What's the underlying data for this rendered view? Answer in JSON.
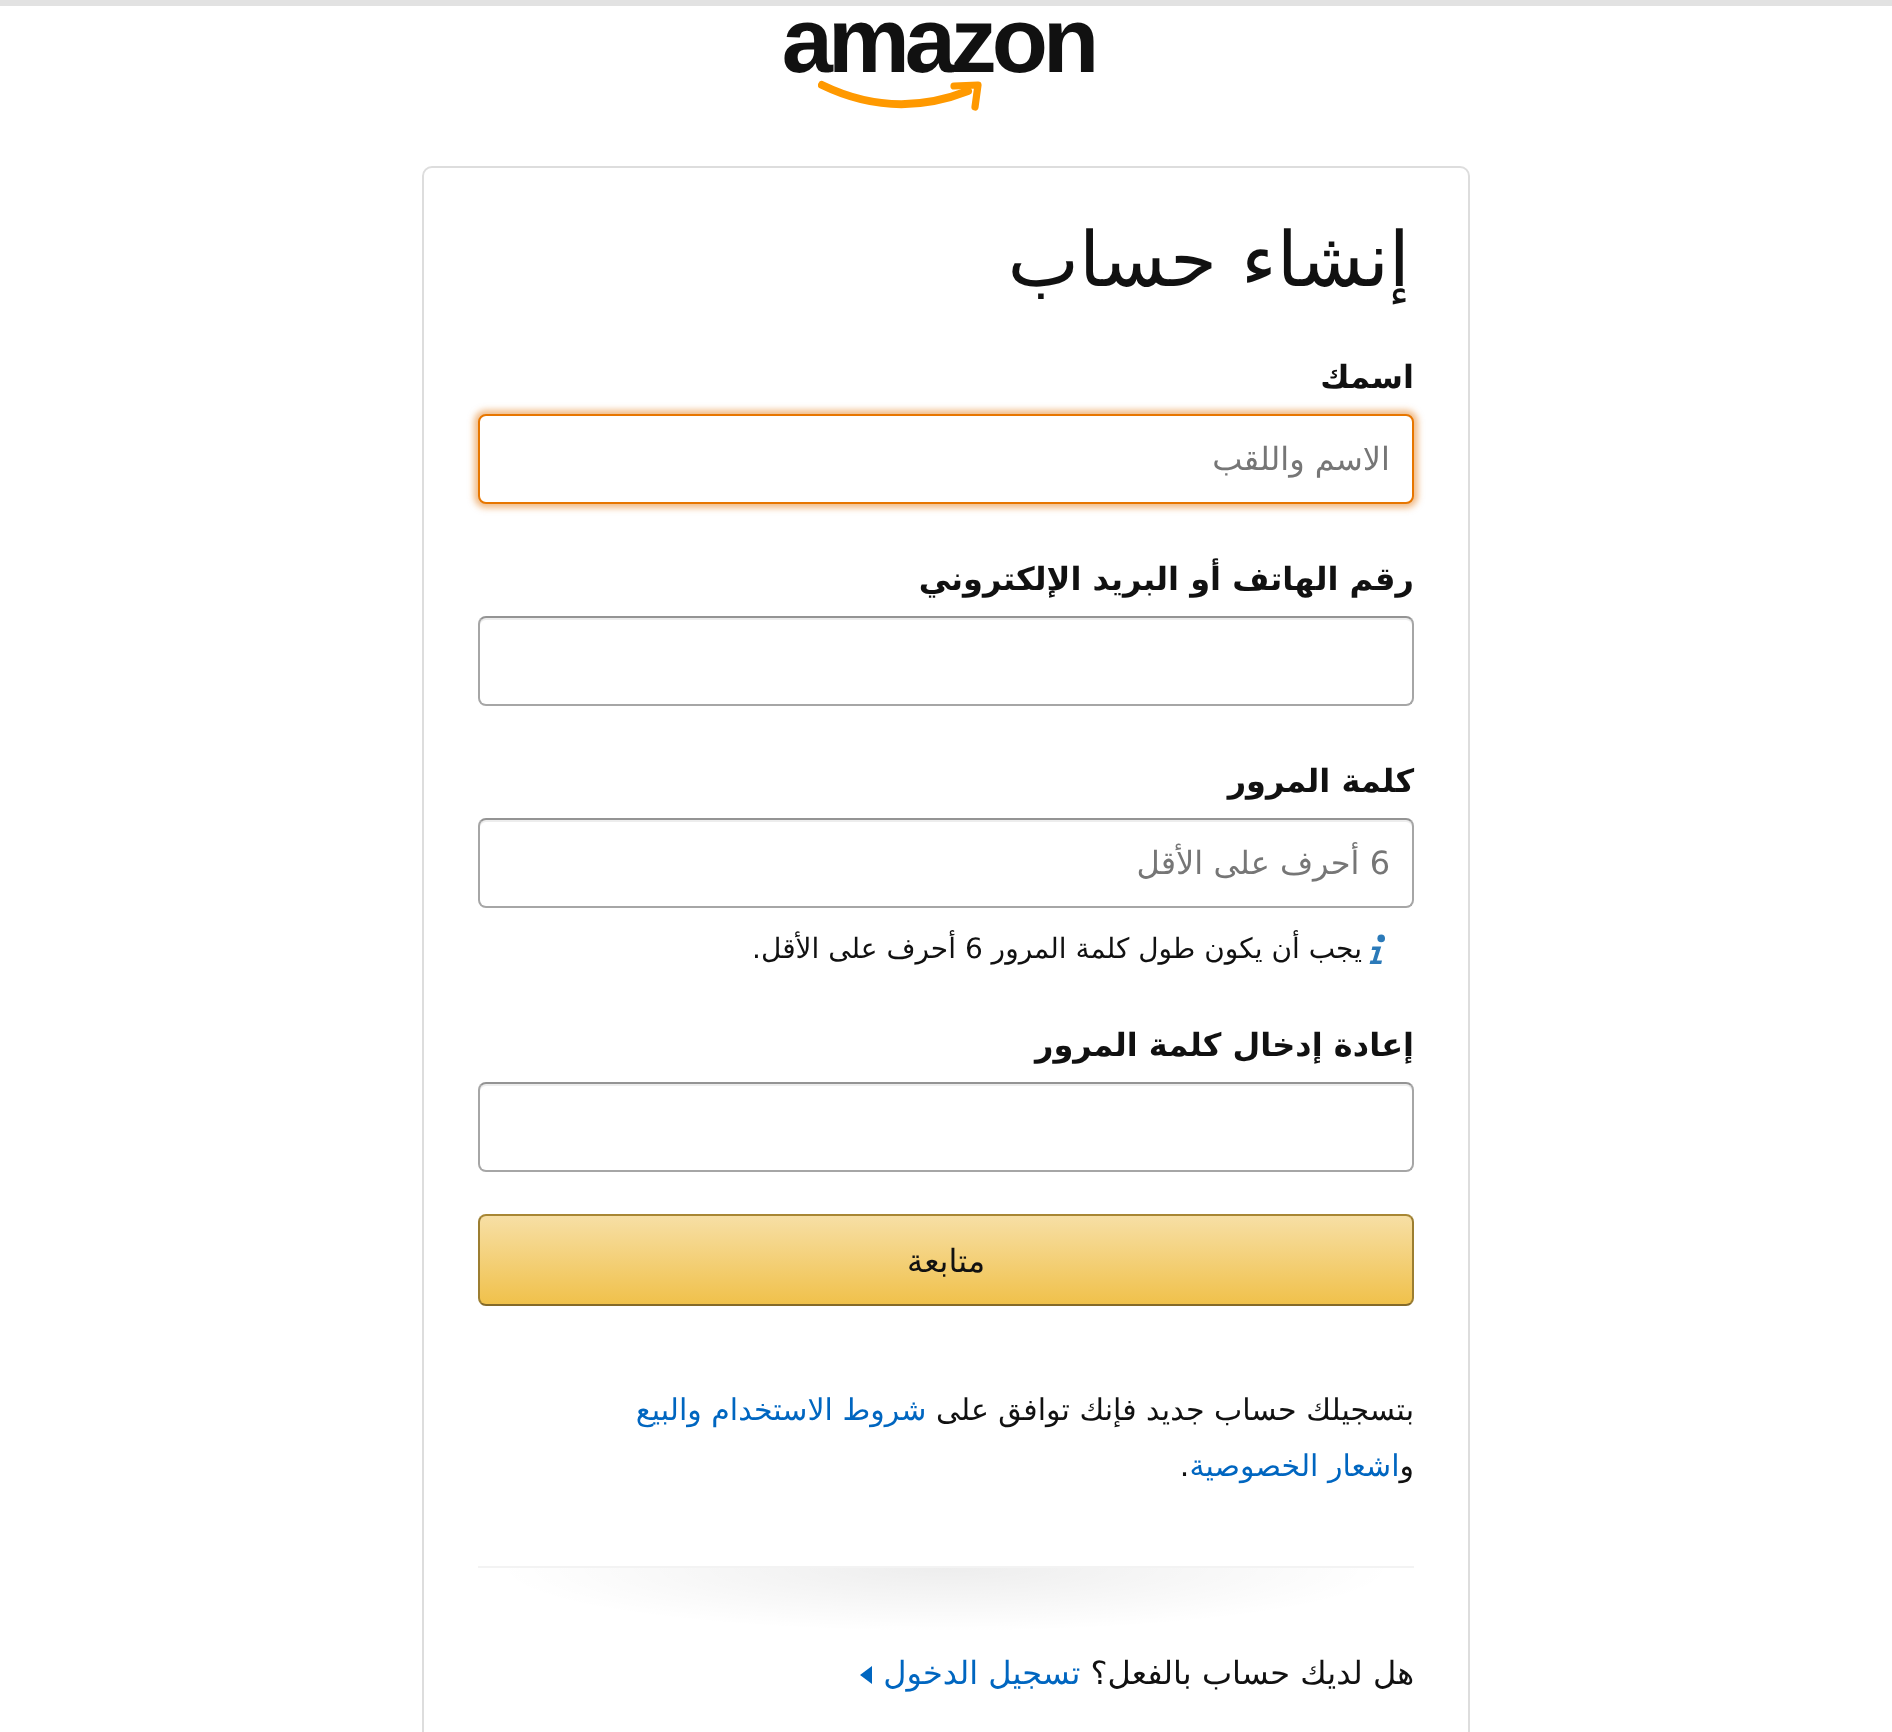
{
  "logo": {
    "text": "amazon"
  },
  "form": {
    "title": "إنشاء حساب",
    "fields": [
      {
        "label": "اسمك",
        "placeholder": "الاسم واللقب",
        "focused": true
      },
      {
        "label": "رقم الهاتف أو البريد الإلكتروني",
        "focused": false
      },
      {
        "label": "كلمة المرور",
        "placeholder": "6 أحرف على الأقل",
        "focused": false,
        "hint": "يجب أن يكون طول كلمة المرور 6 أحرف على الأقل."
      },
      {
        "label": "إعادة إدخال كلمة المرور",
        "focused": false
      }
    ],
    "submit_button": {
      "label": "متابعة"
    },
    "legal_text": [
      {
        "kind": "text",
        "text": "بتسجيلك حساب جديد فإنك توافق على "
      },
      {
        "kind": "link",
        "text": "شروط الاستخدام والبيع"
      },
      {
        "kind": "text",
        "text": " و"
      },
      {
        "kind": "link",
        "text": "اشعار الخصوصية"
      },
      {
        "kind": "text",
        "text": "."
      }
    ],
    "sign_in": {
      "question": "هل لديك حساب بالفعل؟",
      "link": "تسجيل الدخول"
    }
  }
}
